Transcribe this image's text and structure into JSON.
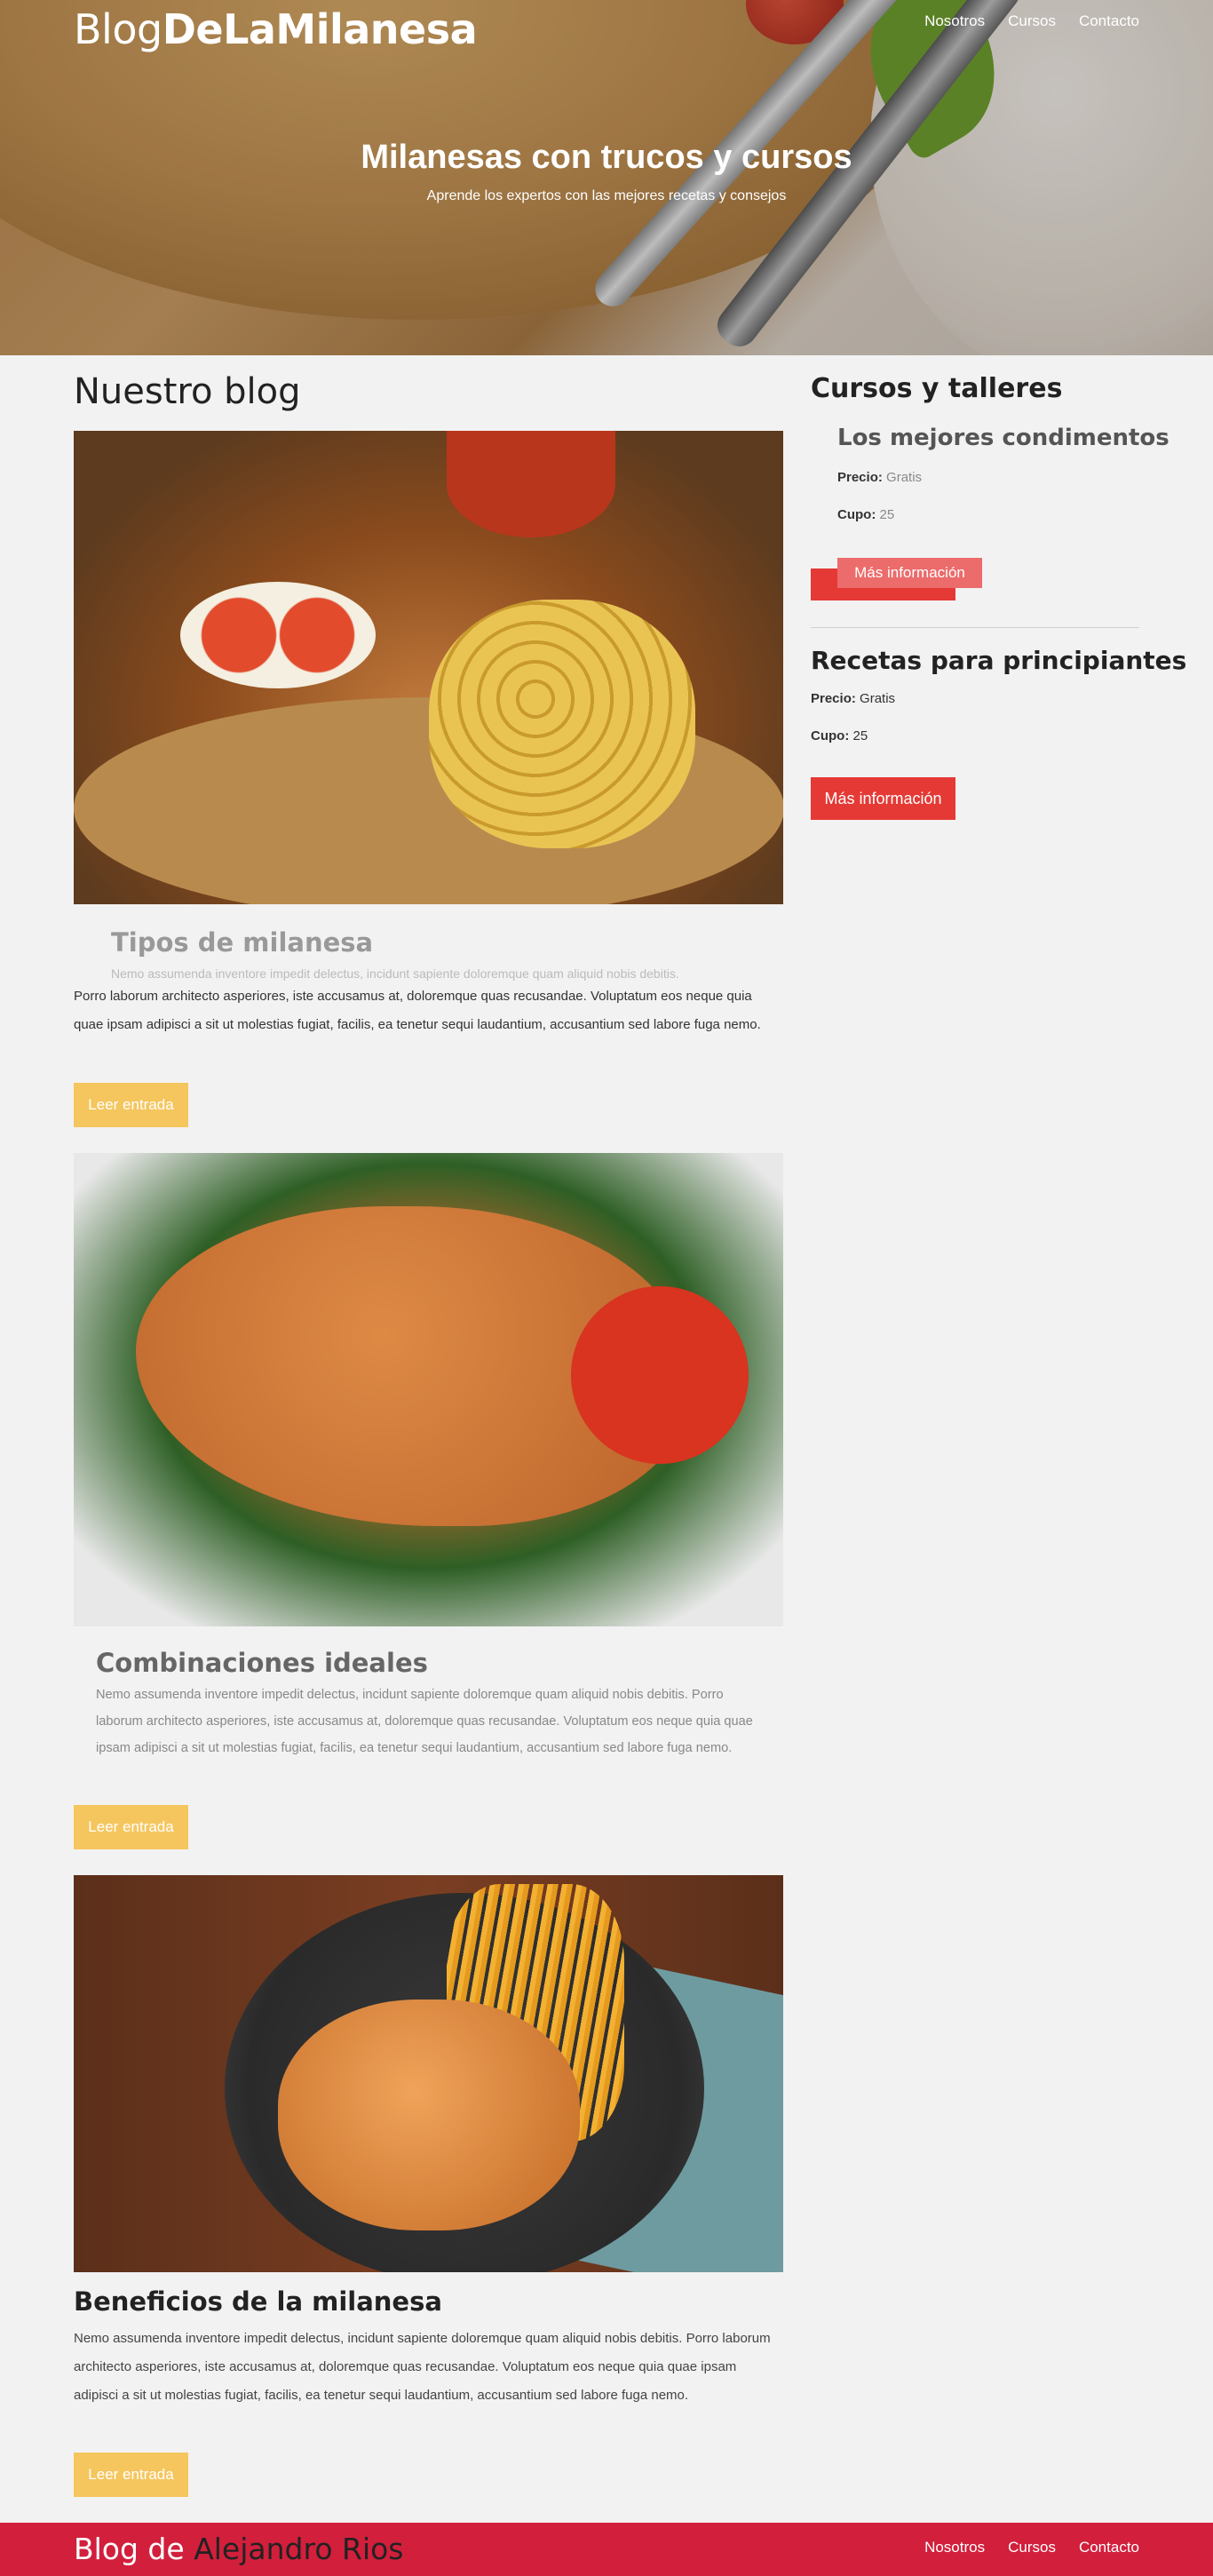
{
  "header": {
    "brand_light": "Blog",
    "brand_bold": "DeLaMilanesa",
    "nav": [
      "Nosotros",
      "Cursos",
      "Contacto"
    ],
    "hero_title": "Milanesas con trucos y cursos",
    "hero_subtitle": "Aprende los expertos con las mejores recetas y consejos"
  },
  "blog": {
    "title": "Nuestro blog",
    "posts": [
      {
        "title": "Tipos de milanesa",
        "faded_line": "Nemo assumenda inventore impedit delectus, incidunt sapiente doloremque quam aliquid nobis debitis.",
        "text": "Porro laborum architecto asperiores, iste accusamus at, doloremque quas recusandae. Voluptatum eos neque quia quae ipsam adipisci a sit ut molestias fugiat, facilis, ea tenetur sequi laudantium, accusantium sed labore fuga nemo.",
        "button": "Leer entrada"
      },
      {
        "title": "Combinaciones ideales",
        "text": "Nemo assumenda inventore impedit delectus, incidunt sapiente doloremque quam aliquid nobis debitis. Porro laborum architecto asperiores, iste accusamus at, doloremque quas recusandae. Voluptatum eos neque quia quae ipsam adipisci a sit ut molestias fugiat, facilis, ea tenetur sequi laudantium, accusantium sed labore fuga nemo.",
        "button": "Leer entrada"
      },
      {
        "title": "Beneficios de la milanesa",
        "text": "Nemo assumenda inventore impedit delectus, incidunt sapiente doloremque quam aliquid nobis debitis. Porro laborum architecto asperiores, iste accusamus at, doloremque quas recusandae. Voluptatum eos neque quia quae ipsam adipisci a sit ut molestias fugiat, facilis, ea tenetur sequi laudantium, accusantium sed labore fuga nemo.",
        "button": "Leer entrada"
      }
    ]
  },
  "sidebar": {
    "title": "Cursos y talleres",
    "courses": [
      {
        "title": "Los mejores condimentos",
        "precio_label": "Precio:",
        "precio": "Gratis",
        "cupo_label": "Cupo:",
        "cupo": "25",
        "button": "Más información"
      },
      {
        "title": "Recetas para principiantes",
        "precio_label": "Precio:",
        "precio": "Gratis",
        "cupo_label": "Cupo:",
        "cupo": "25",
        "button": "Más información"
      }
    ]
  },
  "footer": {
    "brand_prefix": "Blog de",
    "brand_name": "Alejandro Rios",
    "nav": [
      "Nosotros",
      "Cursos",
      "Contacto"
    ]
  },
  "colors": {
    "footer_bg": "#d21f3c",
    "read_button": "#f5c65e",
    "info_button": "#e53935"
  }
}
